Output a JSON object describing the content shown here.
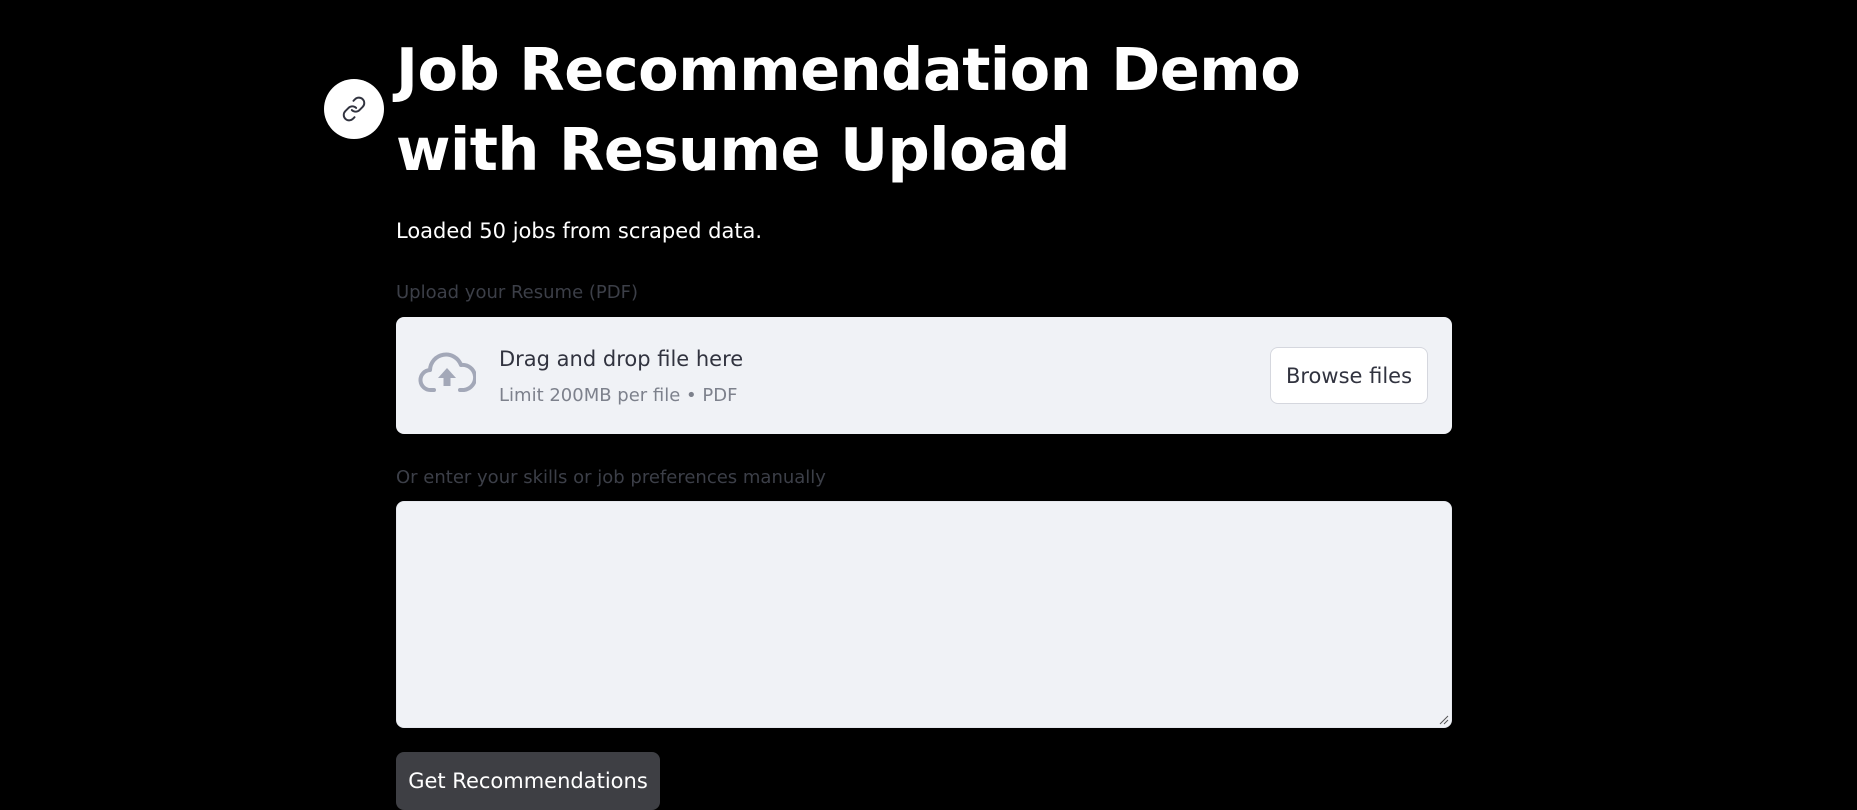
{
  "header": {
    "title": "Job Recommendation Demo with Resume Upload",
    "link_icon": "link-icon"
  },
  "status": {
    "message": "Loaded 50 jobs from scraped data."
  },
  "upload": {
    "label": "Upload your Resume (PDF)",
    "icon": "cloud-upload-icon",
    "instruction": "Drag and drop file here",
    "limit_text": "Limit 200MB per file • PDF",
    "browse_label": "Browse files"
  },
  "manual": {
    "label": "Or enter your skills or job preferences manually",
    "value": "",
    "placeholder": ""
  },
  "actions": {
    "submit_label": "Get Recommendations"
  },
  "colors": {
    "background": "#000000",
    "surface": "#f0f2f6",
    "text_dark": "#31333f",
    "button_dark": "#3e3f44",
    "icon_gray": "#a3a8b8"
  }
}
